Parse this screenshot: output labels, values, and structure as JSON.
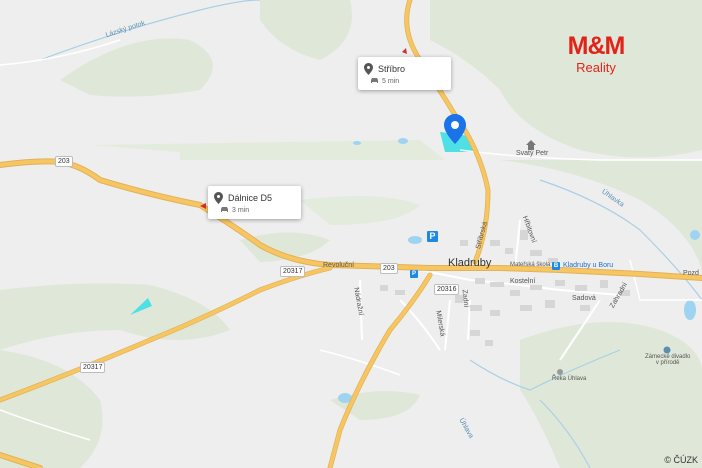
{
  "brand": {
    "name": "M&M",
    "subtitle": "Reality",
    "color": "#e2231a"
  },
  "callouts": [
    {
      "title": "Stříbro",
      "time": "5 min",
      "icon": "car-icon"
    },
    {
      "title": "Dálnice D5",
      "time": "3 min",
      "icon": "car-icon"
    }
  ],
  "marker": {
    "icon": "map-pin-icon",
    "color": "#1a73e8"
  },
  "places": {
    "town": "Kladruby",
    "kindergarten": "Mateřská škola",
    "bus_stop": "Kladruby u Boru",
    "theatre_line1": "Zámecké divadlo",
    "theatre_line2": "v přírodě",
    "river": "Řeka Úhlava",
    "hill": "Svatý Petr",
    "stream": "Lázský potok",
    "uhlavka": "Úhlavka",
    "pozd": "Pozd",
    "uhlava2": "Úhlava"
  },
  "streets": {
    "revolucni": "Revoluční",
    "kostelni": "Kostelní",
    "sadova": "Sadová",
    "zahradni": "Zahradní",
    "hrbitovni": "Hřbitovní",
    "stribrska": "Stříbrská",
    "nadrazni": "Nádražní",
    "milerska": "Milerská",
    "zadni": "Zadní"
  },
  "road_numbers": {
    "r203a": "203",
    "r203b": "203",
    "r20317a": "20317",
    "r20317b": "20317",
    "r20316": "20316"
  },
  "copyright": "© ČÚZK",
  "colors": {
    "road": "#f7c663",
    "water": "#9fd3f2",
    "forest": "#dfe8d8",
    "land": "#eeeeee",
    "highlight": "#4fe0e6"
  }
}
